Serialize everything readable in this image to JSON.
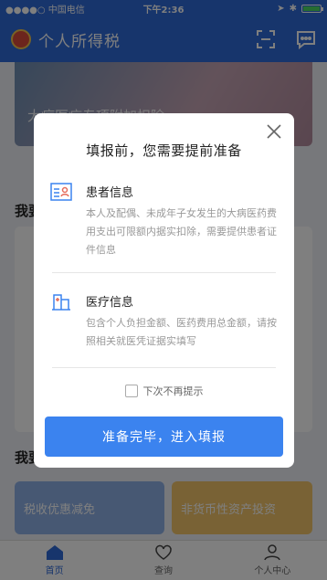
{
  "status_bar": {
    "carrier": "●●●●○ 中国电信",
    "time": "下午2:36"
  },
  "header": {
    "title": "个人所得税"
  },
  "background": {
    "banner_text": "大病医疗专项附加扣除",
    "section1": "我要",
    "section2": "我要",
    "tile_left": "税收优惠减免",
    "tile_right": "非货币性资产投资"
  },
  "tabbar": {
    "items": [
      {
        "label": "首页"
      },
      {
        "label": "查询"
      },
      {
        "label": "个人中心"
      }
    ]
  },
  "modal": {
    "title": "填报前，您需要提前准备",
    "items": [
      {
        "title": "患者信息",
        "desc": "本人及配偶、未成年子女发生的大病医药费用支出可限额内据实扣除，需要提供患者证件信息"
      },
      {
        "title": "医疗信息",
        "desc": "包含个人负担金额、医药费用总金额，请按照相关就医凭证据实填写"
      }
    ],
    "checkbox_label": "下次不再提示",
    "button_label": "准备完毕，进入填报"
  },
  "colors": {
    "primary": "#3b83ef",
    "header": "#2f6ad8"
  }
}
